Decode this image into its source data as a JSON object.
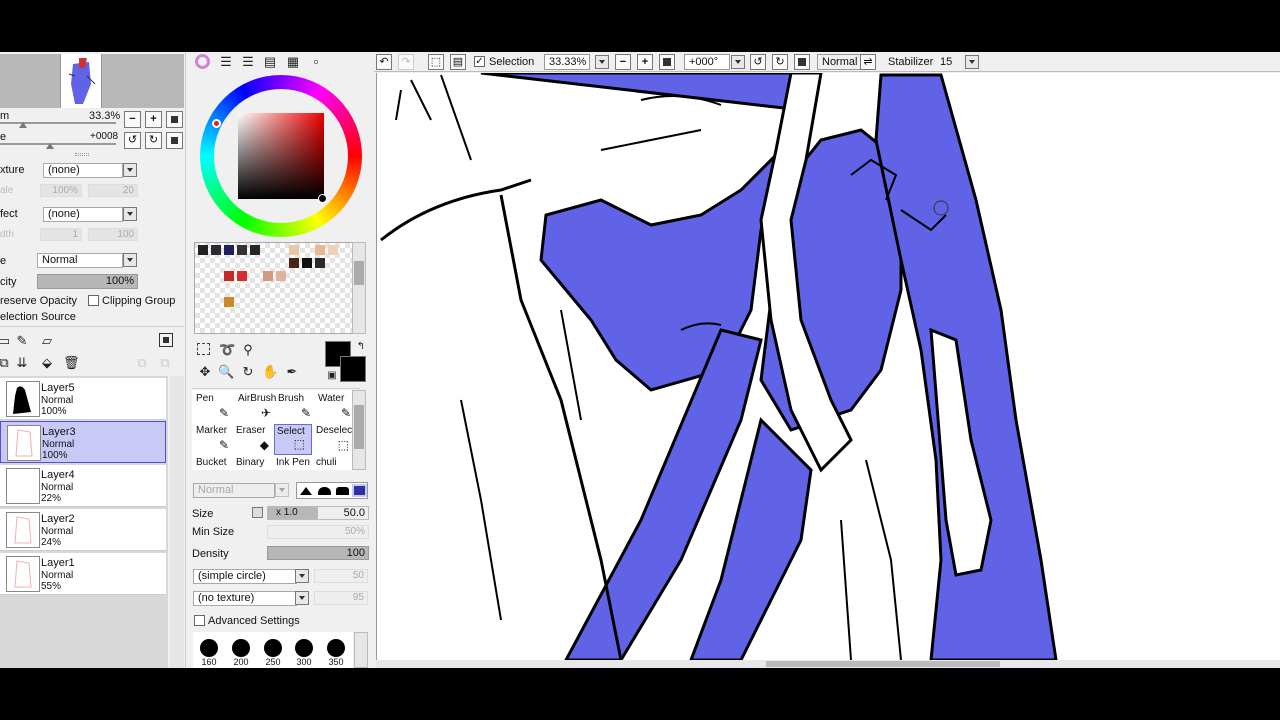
{
  "navigator": {
    "zoom": "33.3%",
    "angle": "+0008"
  },
  "brush_panel": {
    "texture_label": "xture",
    "texture_value": "(none)",
    "texture_field1": "100%",
    "texture_field2": "20",
    "effect_label": "fect",
    "effect_value": "(none)",
    "effect_field1": "1",
    "effect_field2": "100",
    "blend_label": "e",
    "blend_value": "Normal",
    "opacity_label": "city",
    "opacity_value": "100%",
    "preserve_opacity": "reserve Opacity",
    "clipping_group": "Clipping Group",
    "selection_source": "election Source"
  },
  "layers": [
    {
      "name": "Layer5",
      "mode": "Normal",
      "opacity": "100%"
    },
    {
      "name": "Layer3",
      "mode": "Normal",
      "opacity": "100%"
    },
    {
      "name": "Layer4",
      "mode": "Normal",
      "opacity": "22%"
    },
    {
      "name": "Layer2",
      "mode": "Normal",
      "opacity": "24%"
    },
    {
      "name": "Layer1",
      "mode": "Normal",
      "opacity": "55%"
    }
  ],
  "tools": [
    {
      "label": "Pen",
      "icon": "✎"
    },
    {
      "label": "AirBrush",
      "icon": "✈"
    },
    {
      "label": "Brush",
      "icon": "✎"
    },
    {
      "label": "Water",
      "icon": "✎"
    },
    {
      "label": "Marker",
      "icon": "✎"
    },
    {
      "label": "Eraser",
      "icon": "◆"
    },
    {
      "label": "Select",
      "icon": "⬚"
    },
    {
      "label": "Deselect",
      "icon": "⬚"
    },
    {
      "label": "Bucket",
      "icon": ""
    },
    {
      "label": "Binary",
      "icon": ""
    },
    {
      "label": "Ink Pen",
      "icon": ""
    },
    {
      "label": "chuli",
      "icon": ""
    }
  ],
  "tool_settings": {
    "blend": "Normal",
    "size_label": "Size",
    "size_mult": "x 1.0",
    "size_value": "50.0",
    "min_size_label": "Min Size",
    "min_size_value": "50%",
    "density_label": "Density",
    "density_value": "100",
    "shape": "(simple circle)",
    "shape_value": "50",
    "texture": "(no texture)",
    "texture_value": "95",
    "advanced": "Advanced Settings"
  },
  "brush_sizes": [
    "160",
    "200",
    "250",
    "300",
    "350"
  ],
  "toolbar": {
    "selection_label": "Selection",
    "zoom": "33.33%",
    "rotation": "+000°",
    "mode": "Normal",
    "stabilizer_label": "Stabilizer",
    "stabilizer_value": "15"
  },
  "colors": {
    "primary": "#000000",
    "secondary": "#000000",
    "fill": "#6063e6",
    "accent": "#c9c9f7"
  }
}
